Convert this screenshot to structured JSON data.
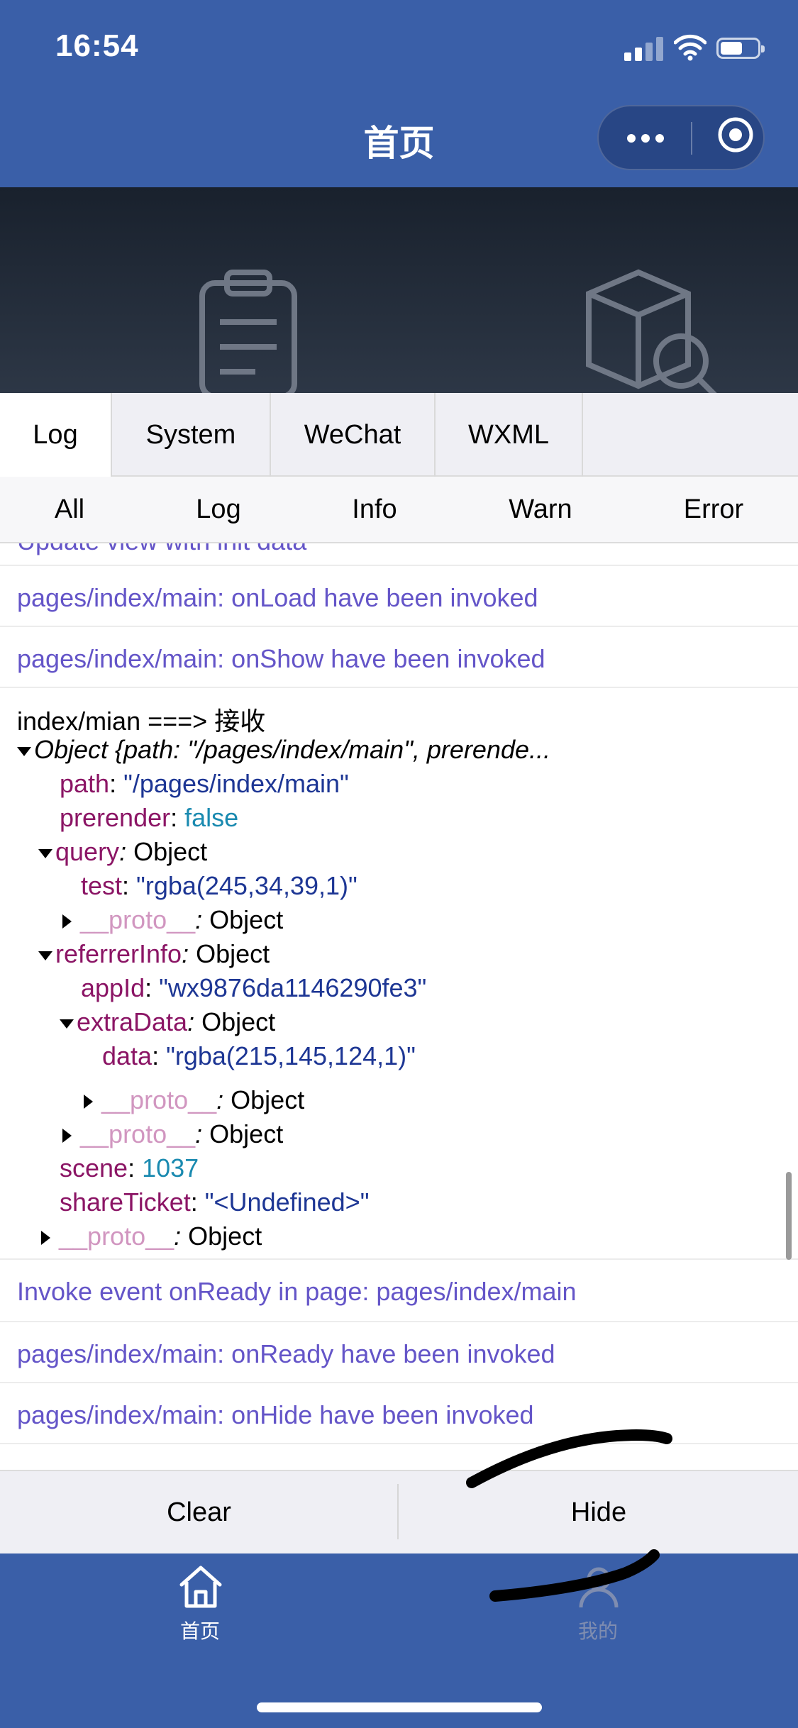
{
  "status_bar": {
    "time": "16:54"
  },
  "nav": {
    "title": "首页"
  },
  "console": {
    "tabs": [
      "Log",
      "System",
      "WeChat",
      "WXML"
    ],
    "active_tab": "Log",
    "filters": [
      "All",
      "Log",
      "Info",
      "Warn",
      "Error"
    ],
    "partial_top_line": "Update view with init data",
    "entries_before": [
      "pages/index/main: onLoad have been invoked",
      "pages/index/main: onShow have been invoked"
    ],
    "object_entry": {
      "header": "index/mian ===> 接收",
      "summary": "Object {path: \"/pages/index/main\", prerende...",
      "path_key": "path",
      "path_value": "\"/pages/index/main\"",
      "prerender_key": "prerender",
      "prerender_value": "false",
      "query_key": "query",
      "object_label": "Object",
      "test_key": "test",
      "test_value": "\"rgba(245,34,39,1)\"",
      "proto_key": "__proto__",
      "referrer_key": "referrerInfo",
      "appid_key": "appId",
      "appid_value": "\"wx9876da1146290fe3\"",
      "extra_key": "extraData",
      "data_key": "data",
      "data_value": "\"rgba(215,145,124,1)\"",
      "scene_key": "scene",
      "scene_value": "1037",
      "share_key": "shareTicket",
      "share_value": "\"<Undefined>\""
    },
    "entries_after": [
      "Invoke event onReady in page: pages/index/main",
      "pages/index/main: onReady have been invoked",
      "pages/index/main: onHide have been invoked"
    ],
    "clear_label": "Clear",
    "hide_label": "Hide"
  },
  "bottom_tabs": [
    {
      "label": "首页",
      "icon": "home-icon"
    },
    {
      "label": "我的",
      "icon": "user-icon"
    }
  ],
  "colors": {
    "brand": "#3a5fa8",
    "log_text": "#6455c8",
    "key": "#8b1565",
    "string": "#1d3694",
    "number": "#1a8ab0"
  }
}
